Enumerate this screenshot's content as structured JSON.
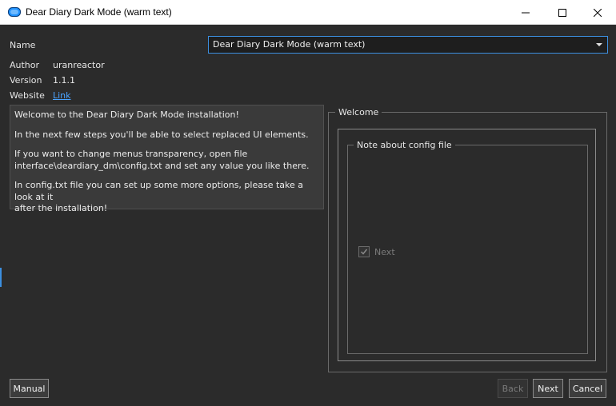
{
  "window": {
    "title": "Dear Diary Dark Mode (warm text)",
    "controls": [
      "minimize",
      "maximize",
      "close"
    ]
  },
  "form": {
    "name_label": "Name",
    "name_value": "Dear Diary Dark Mode (warm text)",
    "author_label": "Author",
    "author_value": "uranreactor",
    "version_label": "Version",
    "version_value": "1.1.1",
    "website_label": "Website",
    "website_link": "Link"
  },
  "description": {
    "paragraphs": [
      "Welcome to the Dear Diary Dark Mode installation!",
      "In the next few steps you'll be able to select replaced UI elements.",
      "If you want to change menus transparency, open file\ninterface\\deardiary_dm\\config.txt and set any value you like there.",
      "In config.txt file you can set up some more options, please take a look at it\nafter the installation!"
    ]
  },
  "panel": {
    "welcome_title": "Welcome",
    "config_title": "Note about config file",
    "checkbox_label": "Next",
    "checkbox_checked": true
  },
  "buttons": {
    "manual": "Manual",
    "back": "Back",
    "next": "Next",
    "cancel": "Cancel"
  },
  "colors": {
    "background": "#2b2b2b",
    "accent": "#3c8fe0",
    "link": "#4aa3ff",
    "app_icon": "#1e90ff"
  }
}
